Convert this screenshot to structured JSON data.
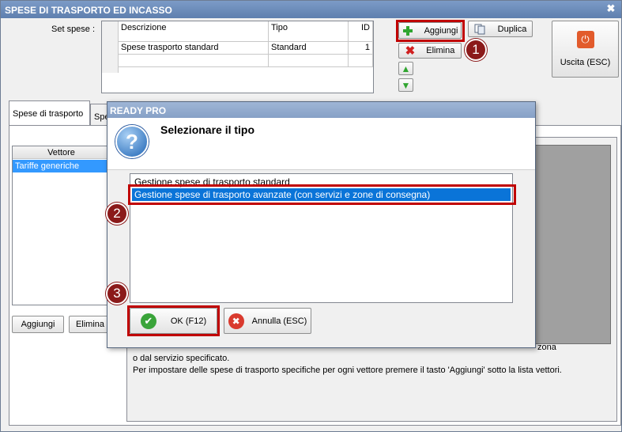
{
  "window": {
    "title": "SPESE DI TRASPORTO ED INCASSO",
    "close_glyph": "✖"
  },
  "set_spese": {
    "label": "Set spese :",
    "columns": [
      "Descrizione",
      "Tipo",
      "ID"
    ],
    "rows": [
      {
        "descrizione": "Spese trasporto standard",
        "tipo": "Standard",
        "id": "1"
      }
    ]
  },
  "toolbar": {
    "aggiungi": "Aggiungi",
    "duplica": "Duplica",
    "elimina": "Elimina",
    "uscita": "Uscita (ESC)"
  },
  "tabs": {
    "tab1": "Spese di trasporto",
    "tab2": "Spe"
  },
  "vettore": {
    "header": "Vettore",
    "items": [
      "Tariffe generiche"
    ],
    "aggiungi": "Aggiungi",
    "elimina": "Elimina"
  },
  "info_text": {
    "line1_tail": "zona",
    "line2": "o dal servizio specificato.",
    "line3": "Per impostare delle spese di trasporto specifiche per ogni vettore premere il tasto 'Aggiungi' sotto la lista vettori."
  },
  "dialog": {
    "title": "READY PRO",
    "heading": "Selezionare il tipo",
    "options": [
      "Gestione spese di trasporto standard",
      "Gestione spese di trasporto avanzate (con servizi e zone di consegna)"
    ],
    "selected_index": 1,
    "ok": "OK (F12)",
    "annulla": "Annulla (ESC)"
  },
  "callouts": [
    "1",
    "2",
    "3"
  ],
  "colors": {
    "highlight": "#c00000",
    "selection": "#0a74d8",
    "badge": "#8b1a1a"
  }
}
